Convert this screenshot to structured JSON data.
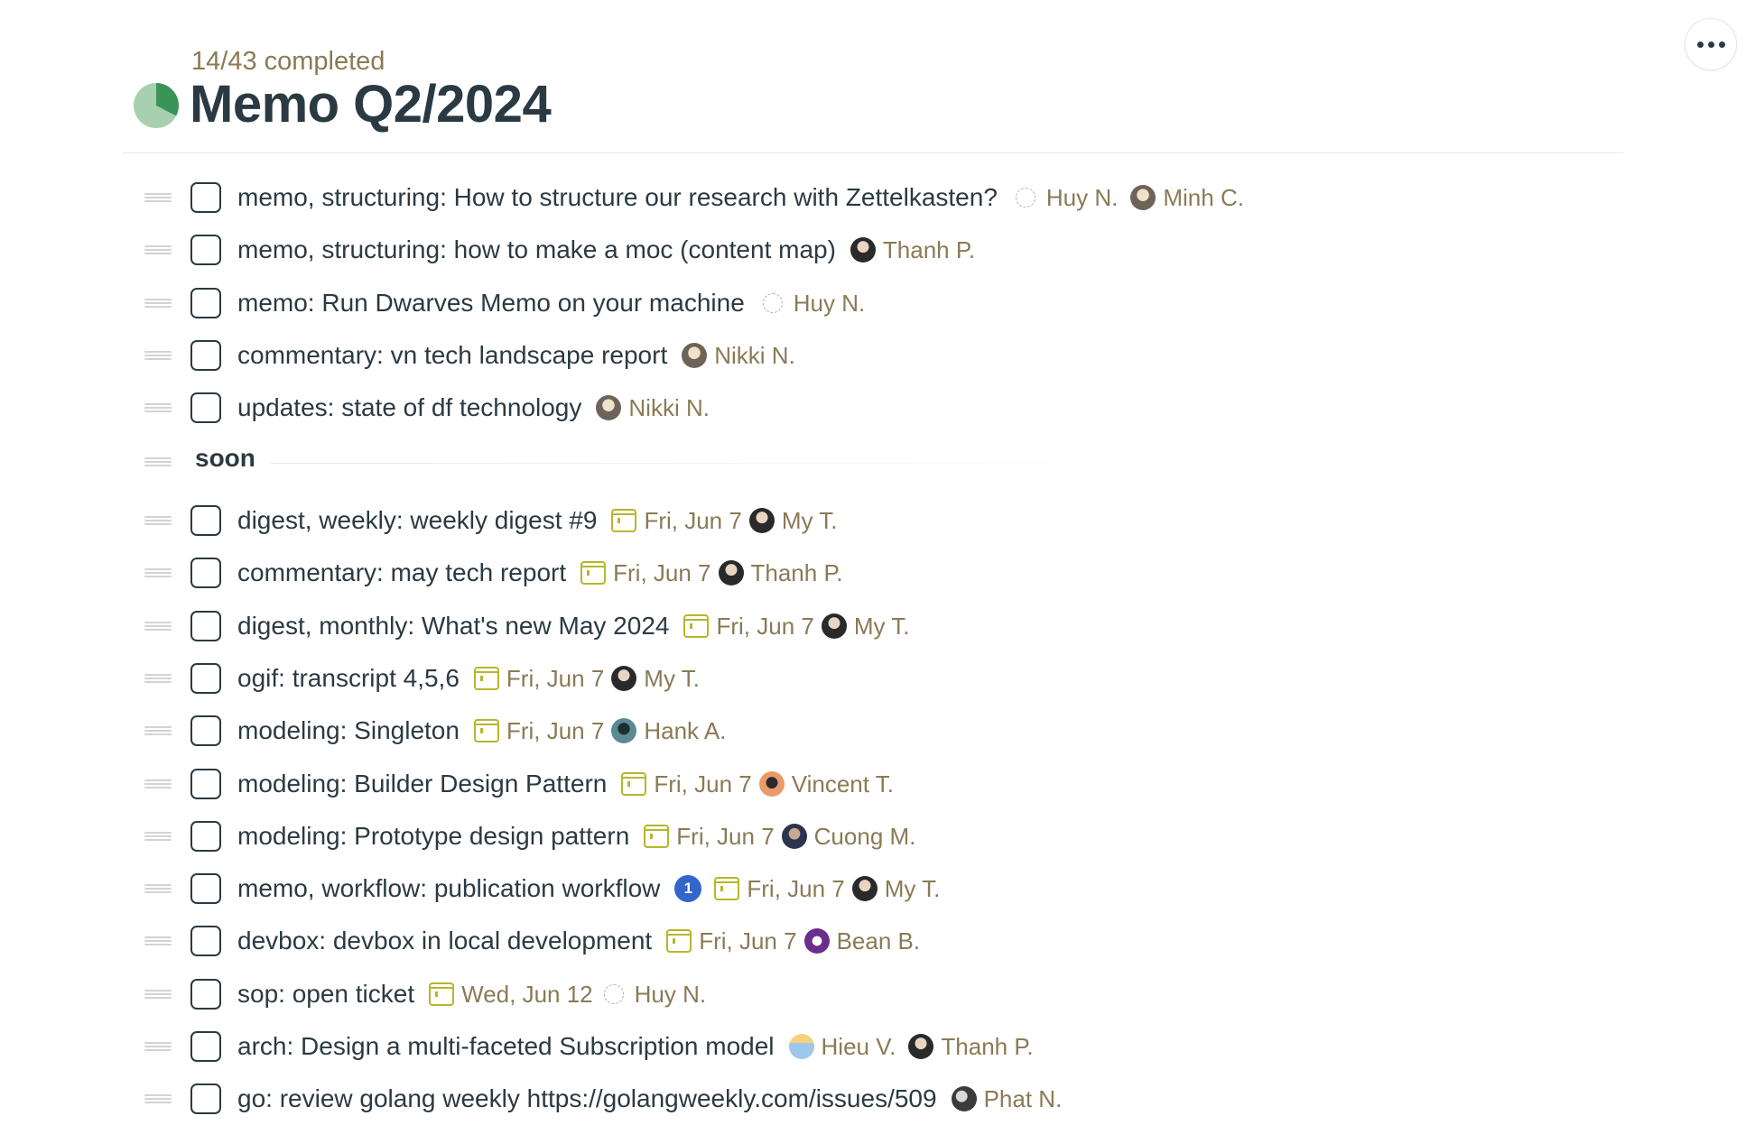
{
  "header": {
    "progress_text": "14/43 completed",
    "progress": {
      "completed": 14,
      "total": 43
    },
    "title": "Memo Q2/2024",
    "colors": {
      "pie_done": "#3a9458",
      "pie_todo": "#a8cfb0",
      "meta_text": "#8a7a55",
      "calendar": "#b6b62c",
      "badge": "#3366cc"
    }
  },
  "toolbar": {
    "more_icon": "more-horizontal-icon"
  },
  "tasks_top": [
    {
      "title": "memo, structuring: How to structure our research with Zettelkasten?",
      "people": [
        {
          "name": "Huy N.",
          "avatar": "ghost"
        },
        {
          "name": "Minh C.",
          "avatar": "light"
        }
      ]
    },
    {
      "title": "memo, structuring: how to make a moc (content map)",
      "people": [
        {
          "name": "Thanh P.",
          "avatar": "dark"
        }
      ]
    },
    {
      "title": "memo: Run Dwarves Memo on your machine",
      "people": [
        {
          "name": "Huy N.",
          "avatar": "ghost"
        }
      ]
    },
    {
      "title": "commentary: vn tech landscape report",
      "people": [
        {
          "name": "Nikki N.",
          "avatar": "light"
        }
      ]
    },
    {
      "title": "updates: state of df technology",
      "people": [
        {
          "name": "Nikki N.",
          "avatar": "light"
        }
      ]
    }
  ],
  "section": {
    "label": "soon"
  },
  "tasks_soon": [
    {
      "title": "digest, weekly: weekly digest #9",
      "date": "Fri, Jun 7",
      "people": [
        {
          "name": "My T.",
          "avatar": "dark"
        }
      ]
    },
    {
      "title": "commentary: may tech report",
      "date": "Fri, Jun 7",
      "people": [
        {
          "name": "Thanh P.",
          "avatar": "dark"
        }
      ]
    },
    {
      "title": "digest, monthly: What's new May 2024",
      "date": "Fri, Jun 7",
      "people": [
        {
          "name": "My T.",
          "avatar": "dark"
        }
      ]
    },
    {
      "title": "ogif: transcript 4,5,6",
      "date": "Fri, Jun 7",
      "people": [
        {
          "name": "My T.",
          "avatar": "dark"
        }
      ]
    },
    {
      "title": "modeling: Singleton",
      "date": "Fri, Jun 7",
      "people": [
        {
          "name": "Hank A.",
          "avatar": "teal"
        }
      ]
    },
    {
      "title": "modeling: Builder Design Pattern",
      "date": "Fri, Jun 7",
      "people": [
        {
          "name": "Vincent T.",
          "avatar": "orange"
        }
      ]
    },
    {
      "title": "modeling: Prototype design pattern",
      "date": "Fri, Jun 7",
      "people": [
        {
          "name": "Cuong M.",
          "avatar": "navy"
        }
      ]
    },
    {
      "title": "memo, workflow: publication workflow",
      "badge": "1",
      "date": "Fri, Jun 7",
      "people": [
        {
          "name": "My T.",
          "avatar": "dark"
        }
      ]
    },
    {
      "title": "devbox: devbox in local development",
      "date": "Fri, Jun 7",
      "people": [
        {
          "name": "Bean B.",
          "avatar": "purple"
        }
      ]
    },
    {
      "title": "sop: open ticket",
      "date": "Wed, Jun 12",
      "people": [
        {
          "name": "Huy N.",
          "avatar": "ghost"
        }
      ]
    },
    {
      "title": "arch: Design a multi-faceted Subscription model",
      "people": [
        {
          "name": "Hieu V.",
          "avatar": "sky"
        },
        {
          "name": "Thanh P.",
          "avatar": "dark"
        }
      ]
    },
    {
      "title": "go: review golang weekly https://golangweekly.com/issues/509",
      "people": [
        {
          "name": "Phat N.",
          "avatar": "bw"
        }
      ]
    }
  ]
}
